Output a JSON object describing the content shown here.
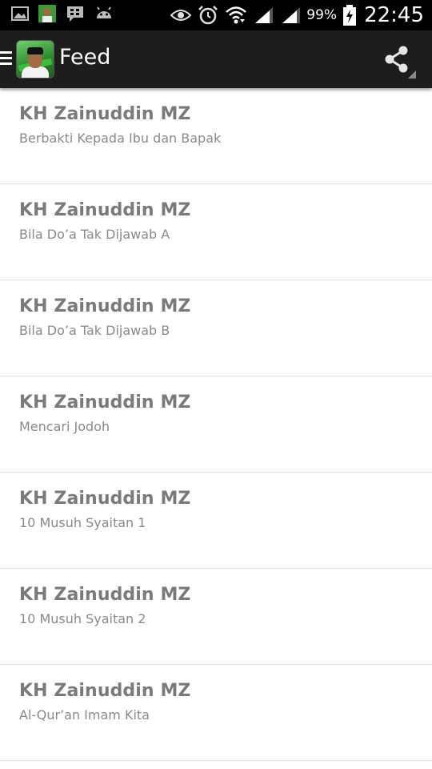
{
  "status_bar": {
    "battery_percent": "99%",
    "time": "22:45",
    "icons_left": [
      "image-icon",
      "app-thumbnail-icon",
      "bbm-icon",
      "android-icon"
    ],
    "icons_right": [
      "eye-icon",
      "alarm-icon",
      "wifi-icon",
      "signal-icon",
      "signal-icon",
      "battery-charging-icon"
    ]
  },
  "action_bar": {
    "title": "Feed",
    "background": "#1d1d1d"
  },
  "feed": {
    "items": [
      {
        "title": "KH Zainuddin MZ",
        "subtitle": "Berbakti Kepada Ibu dan Bapak"
      },
      {
        "title": "KH Zainuddin MZ",
        "subtitle": "Bila Do’a Tak Dijawab A"
      },
      {
        "title": "KH Zainuddin MZ",
        "subtitle": "Bila Do’a Tak Dijawab B"
      },
      {
        "title": "KH Zainuddin MZ",
        "subtitle": "Mencari Jodoh"
      },
      {
        "title": "KH Zainuddin MZ",
        "subtitle": "10 Musuh Syaitan 1"
      },
      {
        "title": "KH Zainuddin MZ",
        "subtitle": "10 Musuh Syaitan 2"
      },
      {
        "title": "KH Zainuddin MZ",
        "subtitle": "Al-Qur’an Imam Kita"
      }
    ]
  }
}
